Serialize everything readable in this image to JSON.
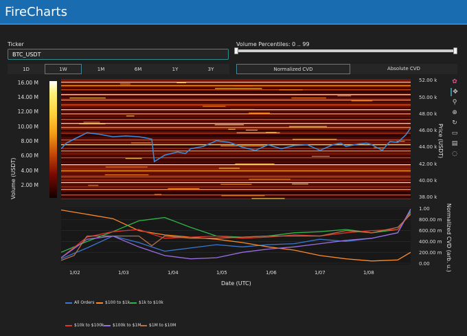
{
  "app": {
    "title": "FireCharts"
  },
  "ticker": {
    "label": "Ticker",
    "value": "BTC_USDT"
  },
  "percentiles": {
    "label": "Volume Percentiles: 0 .. 99",
    "low": 0,
    "high": 99
  },
  "timeframes": [
    {
      "label": "1D",
      "active": false
    },
    {
      "label": "1W",
      "active": true
    },
    {
      "label": "1M",
      "active": false
    },
    {
      "label": "6M",
      "active": false
    },
    {
      "label": "1Y",
      "active": false
    },
    {
      "label": "3Y",
      "active": false
    }
  ],
  "cvd_modes": [
    {
      "label": "Normalized CVD",
      "active": true
    },
    {
      "label": "Absolute CVD",
      "active": false
    }
  ],
  "colorbar": {
    "title": "Volume (USDT)",
    "ticks": [
      "16.00 M",
      "14.00 M",
      "12.00 M",
      "10.00 M",
      "8.00 M",
      "6.00 M",
      "4.00 M",
      "2.00 M"
    ]
  },
  "price_axis": {
    "title": "Price (USDT)",
    "ticks": [
      "52.00 k",
      "50.00 k",
      "48.00 k",
      "46.00 k",
      "44.00 k",
      "42.00 k",
      "40.00 k",
      "38.00 k"
    ]
  },
  "cvd_axis": {
    "title": "Normalized CVD (arb. u.)",
    "ticks": [
      "1.00",
      "800.00 m",
      "600.00 m",
      "400.00 m",
      "200.00 m",
      "0.00"
    ]
  },
  "x_axis": {
    "title": "Date (UTC)",
    "ticks": [
      "1/02",
      "1/03",
      "1/04",
      "1/05",
      "1/06",
      "1/07",
      "1/08"
    ]
  },
  "modebar": [
    "logo-icon",
    "pan-icon",
    "zoom-icon",
    "lasso-icon",
    "reset-icon",
    "download-icon",
    "hover-icon",
    "spike-icon"
  ],
  "legend": [
    {
      "name": "All Orders",
      "color": "#3a78d6"
    },
    {
      "name": "$100 to $1k",
      "color": "#ff8a2a"
    },
    {
      "name": "$1k to $10k",
      "color": "#2fb84a"
    },
    {
      "name": "$10k to $100k",
      "color": "#e0352b"
    },
    {
      "name": "$100k to $1M",
      "color": "#9c6ee6"
    },
    {
      "name": "$1M to $10M",
      "color": "#b8714a"
    }
  ],
  "chart_data": {
    "type": "heatmap",
    "x_ticks": [
      "1/02",
      "1/03",
      "1/04",
      "1/05",
      "1/06",
      "1/07",
      "1/08"
    ],
    "price_ylim": [
      37500,
      52500
    ],
    "cvd_ylim": [
      0,
      1
    ],
    "price_series": {
      "name": "Price",
      "x": [
        0,
        0.2,
        0.5,
        1.0,
        1.5,
        2.0,
        2.5,
        3.0,
        3.2,
        3.5,
        3.6,
        4.0,
        4.5,
        4.8,
        5.0,
        5.5,
        6.0,
        6.5,
        7.0,
        7.5,
        8.0,
        8.5,
        9.0,
        9.5,
        10.0,
        10.5,
        10.8,
        11.0,
        11.5,
        11.8,
        12.0,
        12.4,
        12.7,
        13.0,
        13.3,
        13.5
      ],
      "y": [
        43800,
        44500,
        45000,
        45800,
        45600,
        45300,
        45400,
        45300,
        45200,
        45000,
        42200,
        43000,
        43400,
        43200,
        43800,
        44100,
        44800,
        44600,
        44000,
        43600,
        44300,
        43800,
        44200,
        44300,
        43600,
        44300,
        44500,
        44100,
        44400,
        44500,
        44300,
        43600,
        44700,
        44600,
        45500,
        46400
      ]
    },
    "cvd_series": [
      {
        "name": "All Orders",
        "x": [
          0,
          1,
          2,
          3,
          4,
          5,
          6,
          7,
          8,
          9,
          10,
          11,
          12,
          13,
          13.5
        ],
        "y": [
          0.08,
          0.28,
          0.5,
          0.38,
          0.22,
          0.28,
          0.34,
          0.3,
          0.34,
          0.36,
          0.44,
          0.4,
          0.46,
          0.56,
          0.98
        ]
      },
      {
        "name": "$100 to $1k",
        "x": [
          0,
          1,
          2,
          3,
          4,
          5,
          6,
          7,
          8,
          9,
          10,
          11,
          12,
          13,
          13.5
        ],
        "y": [
          0.98,
          0.9,
          0.82,
          0.6,
          0.52,
          0.48,
          0.44,
          0.38,
          0.3,
          0.24,
          0.14,
          0.08,
          0.04,
          0.06,
          0.2
        ]
      },
      {
        "name": "$1k to $10k",
        "x": [
          0,
          1,
          2,
          3,
          4,
          5,
          6,
          7,
          8,
          9,
          10,
          11,
          12,
          13,
          13.5
        ],
        "y": [
          0.2,
          0.4,
          0.58,
          0.78,
          0.84,
          0.66,
          0.5,
          0.48,
          0.5,
          0.56,
          0.58,
          0.62,
          0.56,
          0.62,
          0.95
        ]
      },
      {
        "name": "$10k to $100k",
        "x": [
          0,
          1,
          2,
          3,
          4,
          5,
          6,
          7,
          8,
          9,
          10,
          11,
          12,
          13,
          13.5
        ],
        "y": [
          0.1,
          0.48,
          0.58,
          0.62,
          0.46,
          0.48,
          0.5,
          0.46,
          0.48,
          0.52,
          0.5,
          0.56,
          0.6,
          0.62,
          0.92
        ]
      },
      {
        "name": "$100k to $1M",
        "x": [
          0,
          1,
          2,
          3,
          4,
          5,
          6,
          7,
          8,
          9,
          10,
          11,
          12,
          13,
          13.5
        ],
        "y": [
          0.1,
          0.44,
          0.5,
          0.3,
          0.14,
          0.08,
          0.1,
          0.2,
          0.26,
          0.3,
          0.36,
          0.42,
          0.46,
          0.56,
          1.0
        ]
      },
      {
        "name": "$1M to $10M",
        "x": [
          0,
          0.5,
          1,
          2,
          3,
          3.5,
          4,
          5,
          6,
          7,
          8,
          9,
          10,
          11,
          12,
          13,
          13.5
        ],
        "y": [
          0.05,
          0.14,
          0.5,
          0.5,
          0.5,
          0.32,
          0.5,
          0.46,
          0.46,
          0.48,
          0.5,
          0.5,
          0.5,
          0.6,
          0.56,
          0.66,
          0.9
        ]
      }
    ]
  }
}
